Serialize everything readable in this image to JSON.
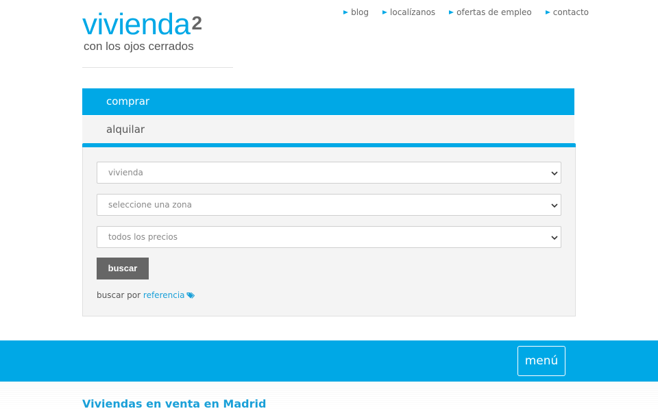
{
  "logo": {
    "main": "vivienda",
    "sup": "2",
    "tagline": "con los ojos cerrados"
  },
  "topnav": [
    {
      "label": "blog"
    },
    {
      "label": "localízanos"
    },
    {
      "label": "ofertas de empleo"
    },
    {
      "label": "contacto"
    }
  ],
  "tabs": {
    "buy": "comprar",
    "rent": "alquilar"
  },
  "search": {
    "type_value": "vivienda",
    "zone_value": "seleccione una zona",
    "price_value": "todos los precios",
    "submit_label": "buscar",
    "ref_prefix": "buscar por",
    "ref_link": "referencia"
  },
  "menu": {
    "label": "menú"
  },
  "section": {
    "title": "Viviendas en venta en Madrid"
  },
  "colors": {
    "accent": "#00a8e6",
    "button_gray": "#666666",
    "panel_bg": "#f4f4f4"
  },
  "icons": {
    "nav_bullet": "triangle-bullet-icon",
    "select_arrow": "chevron-down-icon",
    "reference": "tags-icon"
  }
}
